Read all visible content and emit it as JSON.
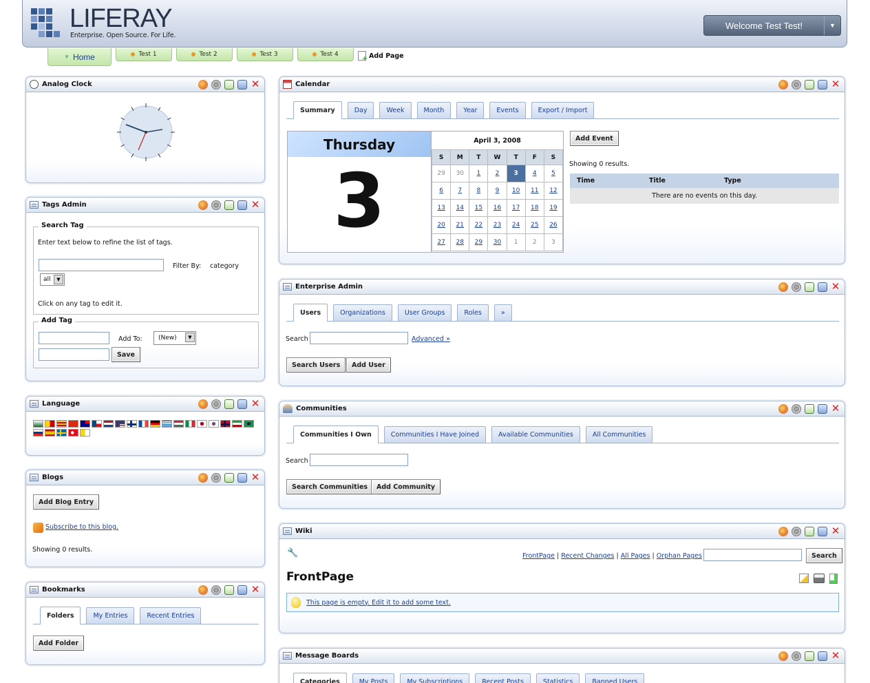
{
  "header": {
    "logo": "LIFERAY",
    "tagline": "Enterprise. Open Source. For Life.",
    "welcome": "Welcome Test Test!"
  },
  "nav": {
    "tabs": [
      "Home",
      "Test 1",
      "Test 2",
      "Test 3",
      "Test 4"
    ],
    "add_page": "Add Page"
  },
  "portlets": {
    "clock": {
      "title": "Analog Clock"
    },
    "tags": {
      "title": "Tags Admin",
      "search_legend": "Search Tag",
      "intro": "Enter text below to refine the list of tags.",
      "filter_label": "Filter By:",
      "filter_value": "category",
      "select_value": "all",
      "click_hint": "Click on any tag to edit it.",
      "add_legend": "Add Tag",
      "add_to_label": "Add To:",
      "add_to_value": "(New)",
      "save": "Save"
    },
    "language": {
      "title": "Language"
    },
    "blogs": {
      "title": "Blogs",
      "add": "Add Blog Entry",
      "subscribe": "Subscribe to this blog.",
      "results": "Showing 0 results."
    },
    "bookmarks": {
      "title": "Bookmarks",
      "tabs": [
        "Folders",
        "My Entries",
        "Recent Entries"
      ],
      "add": "Add Folder"
    },
    "calendar": {
      "title": "Calendar",
      "tabs": [
        "Summary",
        "Day",
        "Week",
        "Month",
        "Year",
        "Events",
        "Export / Import"
      ],
      "weekday": "Thursday",
      "day": "3",
      "month_title": "April 3, 2008",
      "dow": [
        "S",
        "M",
        "T",
        "W",
        "T",
        "F",
        "S"
      ],
      "weeks": [
        [
          "29",
          "30",
          "1",
          "2",
          "3",
          "4",
          "5"
        ],
        [
          "6",
          "7",
          "8",
          "9",
          "10",
          "11",
          "12"
        ],
        [
          "13",
          "14",
          "15",
          "16",
          "17",
          "18",
          "19"
        ],
        [
          "20",
          "21",
          "22",
          "23",
          "24",
          "25",
          "26"
        ],
        [
          "27",
          "28",
          "29",
          "30",
          "1",
          "2",
          "3"
        ]
      ],
      "add_event": "Add Event",
      "results": "Showing 0 results.",
      "cols": [
        "Time",
        "Title",
        "Type"
      ],
      "empty": "There are no events on this day."
    },
    "enterprise": {
      "title": "Enterprise Admin",
      "tabs": [
        "Users",
        "Organizations",
        "User Groups",
        "Roles",
        "»"
      ],
      "search_label": "Search",
      "advanced": "Advanced »",
      "search_btn": "Search Users",
      "add_btn": "Add User"
    },
    "communities": {
      "title": "Communities",
      "tabs": [
        "Communities I Own",
        "Communities I Have Joined",
        "Available Communities",
        "All Communities"
      ],
      "search_label": "Search",
      "search_btn": "Search Communities",
      "add_btn": "Add Community"
    },
    "wiki": {
      "title": "Wiki",
      "links": [
        "FrontPage",
        "Recent Changes",
        "All Pages",
        "Orphan Pages"
      ],
      "search_btn": "Search",
      "page_title": "FrontPage",
      "empty": "This page is empty. Edit it to add some text."
    },
    "boards": {
      "title": "Message Boards",
      "tabs": [
        "Categories",
        "My Posts",
        "My Subscriptions",
        "Recent Posts",
        "Statistics",
        "Banned Users"
      ]
    }
  }
}
